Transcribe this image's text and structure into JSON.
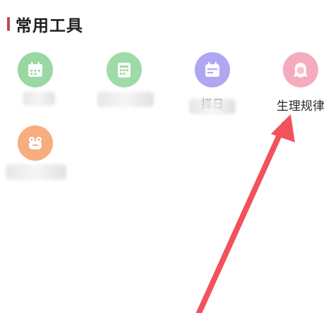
{
  "section": {
    "title": "常用工具",
    "accent_color": "#b84c57"
  },
  "tools": [
    {
      "label": "",
      "icon": "calendar-icon",
      "color": "#8fd39a"
    },
    {
      "label": "",
      "icon": "almanac-icon",
      "color": "#94d89f"
    },
    {
      "label": "择日",
      "icon": "date-picker-icon",
      "color": "#a79ef0"
    },
    {
      "label": "生理规律",
      "icon": "woman-face-icon",
      "color": "#f4a3b8"
    },
    {
      "label": "",
      "icon": "frog-icon",
      "color": "#f7a56f"
    }
  ],
  "partial_labels": {
    "tool_3": "择日",
    "tool_5": "历史"
  },
  "annotation": {
    "arrow_color": "#f2525b"
  }
}
